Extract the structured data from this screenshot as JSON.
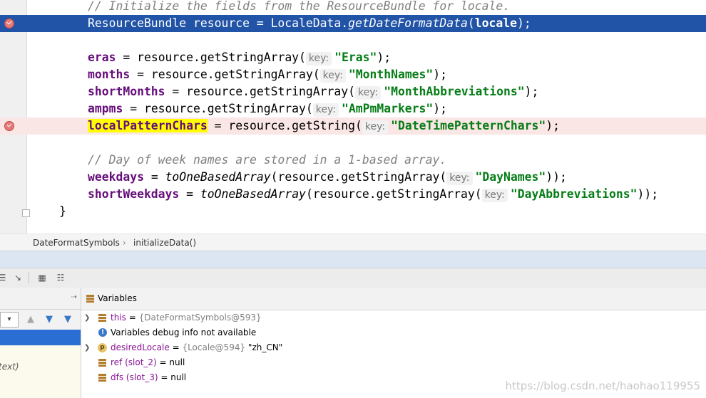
{
  "editor": {
    "lines": [
      {
        "comment": "// Initialize the fields from the ResourceBundle for locale."
      },
      {
        "pre": "ResourceBundle resource = LocaleData.",
        "method": "getDateFormatData",
        "paren": "(",
        "arg": "locale",
        "post": ");"
      },
      {
        "field": "eras",
        "mid": " = resource.getStringArray(",
        "hint": "key:",
        "str": "\"Eras\"",
        "post": ");"
      },
      {
        "field": "months",
        "mid": " = resource.getStringArray(",
        "hint": "key:",
        "str": "\"MonthNames\"",
        "post": ");"
      },
      {
        "field": "shortMonths",
        "mid": " = resource.getStringArray(",
        "hint": "key:",
        "str": "\"MonthAbbreviations\"",
        "post": ");"
      },
      {
        "field": "ampms",
        "mid": " = resource.getStringArray(",
        "hint": "key:",
        "str": "\"AmPmMarkers\"",
        "post": ");"
      },
      {
        "field": "localPatternChars",
        "mid": " = resource.getString(",
        "hint": "key:",
        "str": "\"DateTimePatternChars\"",
        "post": ");"
      },
      {
        "comment": "// Day of week names are stored in a 1-based array."
      },
      {
        "field": "weekdays",
        "mid": " = ",
        "method": "toOneBasedArray",
        "mid2": "(resource.getStringArray(",
        "hint": "key:",
        "str": "\"DayNames\"",
        "post": "));"
      },
      {
        "field": "shortWeekdays",
        "mid": " = ",
        "method": "toOneBasedArray",
        "mid2": "(resource.getStringArray(",
        "hint": "key:",
        "str": "\"DayAbbreviations\"",
        "post": "));"
      }
    ],
    "closing_brace": "}"
  },
  "breadcrumb": {
    "items": [
      "DateFormatSymbols",
      "initializeData()"
    ],
    "separator": "›"
  },
  "frames": {
    "pin": "⇢",
    "partial_text": "text)"
  },
  "variables": {
    "title": "Variables",
    "rows": [
      {
        "name": "this",
        "eq": " = ",
        "type": "{DateFormatSymbols@593}",
        "value": ""
      },
      {
        "name": "",
        "eq": "",
        "type": "",
        "value": "Variables debug info not available"
      },
      {
        "name": "desiredLocale",
        "eq": " = ",
        "type": "{Locale@594}",
        "value": " \"zh_CN\""
      },
      {
        "name": "ref (slot_2)",
        "eq": " = ",
        "type": "",
        "value": "null"
      },
      {
        "name": "dfs (slot_3)",
        "eq": " = ",
        "type": "",
        "value": "null"
      }
    ]
  },
  "watermark": "https://blog.csdn.net/haohao119955"
}
